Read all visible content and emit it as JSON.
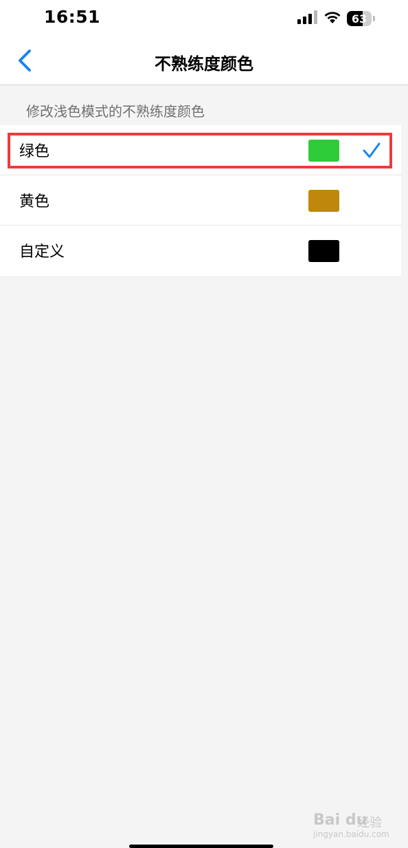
{
  "status_bar": {
    "time": "16:51",
    "battery_text": "63",
    "battery_level": 0.63
  },
  "nav": {
    "title": "不熟练度颜色"
  },
  "section": {
    "header": "修改浅色模式的不熟练度颜色"
  },
  "options": [
    {
      "label": "绿色",
      "color": "#2ecc38",
      "selected": true
    },
    {
      "label": "黄色",
      "color": "#bf880c",
      "selected": false
    },
    {
      "label": "自定义",
      "color": "#000000",
      "selected": false
    }
  ],
  "colors": {
    "accent": "#1a84f0",
    "highlight": "#ee3b3b"
  },
  "watermark": {
    "logo": "Bai du",
    "suffix": "经验",
    "url": "jingyan.baidu.com"
  }
}
